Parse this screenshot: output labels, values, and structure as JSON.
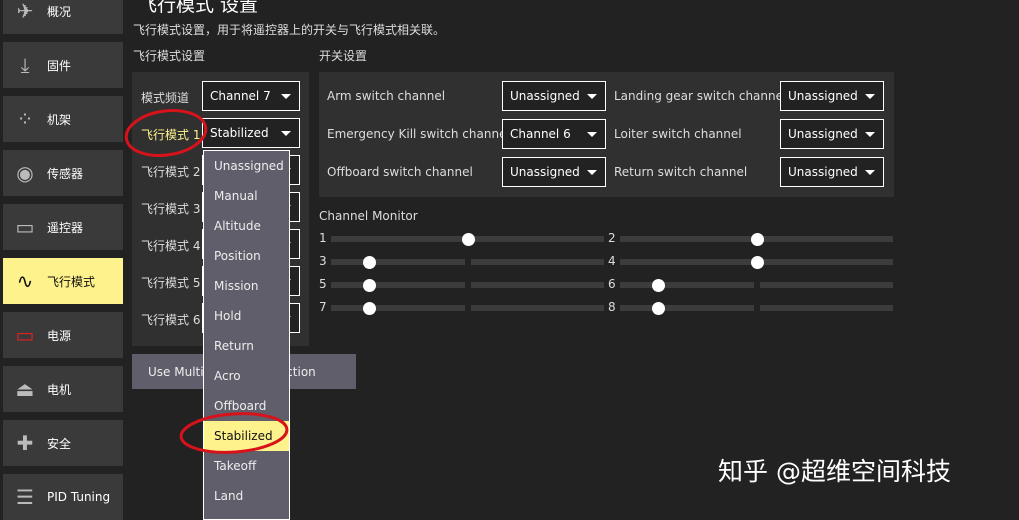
{
  "sidebar": {
    "items": [
      {
        "label": "概况",
        "icon": "plane-icon"
      },
      {
        "label": "固件",
        "icon": "download-icon"
      },
      {
        "label": "机架",
        "icon": "airframe-icon"
      },
      {
        "label": "传感器",
        "icon": "sensor-icon"
      },
      {
        "label": "遥控器",
        "icon": "radio-icon"
      },
      {
        "label": "飞行模式",
        "icon": "flight-mode-icon",
        "active": true
      },
      {
        "label": "电源",
        "icon": "battery-icon"
      },
      {
        "label": "电机",
        "icon": "motor-icon"
      },
      {
        "label": "安全",
        "icon": "safety-icon"
      },
      {
        "label": "PID Tuning",
        "icon": "pid-icon"
      }
    ]
  },
  "header": {
    "title": "飞行模式 设置",
    "description": "飞行模式设置，用于将遥控器上的开关与飞行模式相关联。"
  },
  "flight_modes": {
    "section": "飞行模式设置",
    "channel_label": "模式频道",
    "channel_value": "Channel 7",
    "modes": [
      {
        "label": "飞行模式 1",
        "value": "Stabilized"
      },
      {
        "label": "飞行模式 2",
        "value": ""
      },
      {
        "label": "飞行模式 3",
        "value": ""
      },
      {
        "label": "飞行模式 4",
        "value": ""
      },
      {
        "label": "飞行模式 5",
        "value": ""
      },
      {
        "label": "飞行模式 6",
        "value": ""
      }
    ],
    "multi_button": "Use Multi Channel Selection"
  },
  "switches": {
    "section": "开关设置",
    "items": [
      {
        "label": "Arm switch channel",
        "value": "Unassigned"
      },
      {
        "label": "Landing gear switch channel",
        "value": "Unassigned"
      },
      {
        "label": "Emergency Kill switch channel",
        "value": "Channel 6"
      },
      {
        "label": "Loiter switch channel",
        "value": "Unassigned"
      },
      {
        "label": "Offboard switch channel",
        "value": "Unassigned"
      },
      {
        "label": "Return switch channel",
        "value": "Unassigned"
      }
    ]
  },
  "monitor": {
    "title": "Channel Monitor",
    "channels": [
      {
        "label": "1",
        "value": 0.5
      },
      {
        "label": "2",
        "value": 0.5
      },
      {
        "label": "3",
        "value": 0.14
      },
      {
        "label": "4",
        "value": 0.5
      },
      {
        "label": "5",
        "value": 0.14
      },
      {
        "label": "6",
        "value": 0.14
      },
      {
        "label": "7",
        "value": 0.14
      },
      {
        "label": "8",
        "value": 0.14
      }
    ]
  },
  "dropdown": {
    "options": [
      "Unassigned",
      "Manual",
      "Altitude",
      "Position",
      "Mission",
      "Hold",
      "Return",
      "Acro",
      "Offboard",
      "Stabilized",
      "Takeoff",
      "Land"
    ],
    "selected": "Stabilized"
  },
  "watermark": "知乎 @超维空间科技",
  "colors": {
    "accent": "#fef28d",
    "annotation": "#d8121a"
  }
}
